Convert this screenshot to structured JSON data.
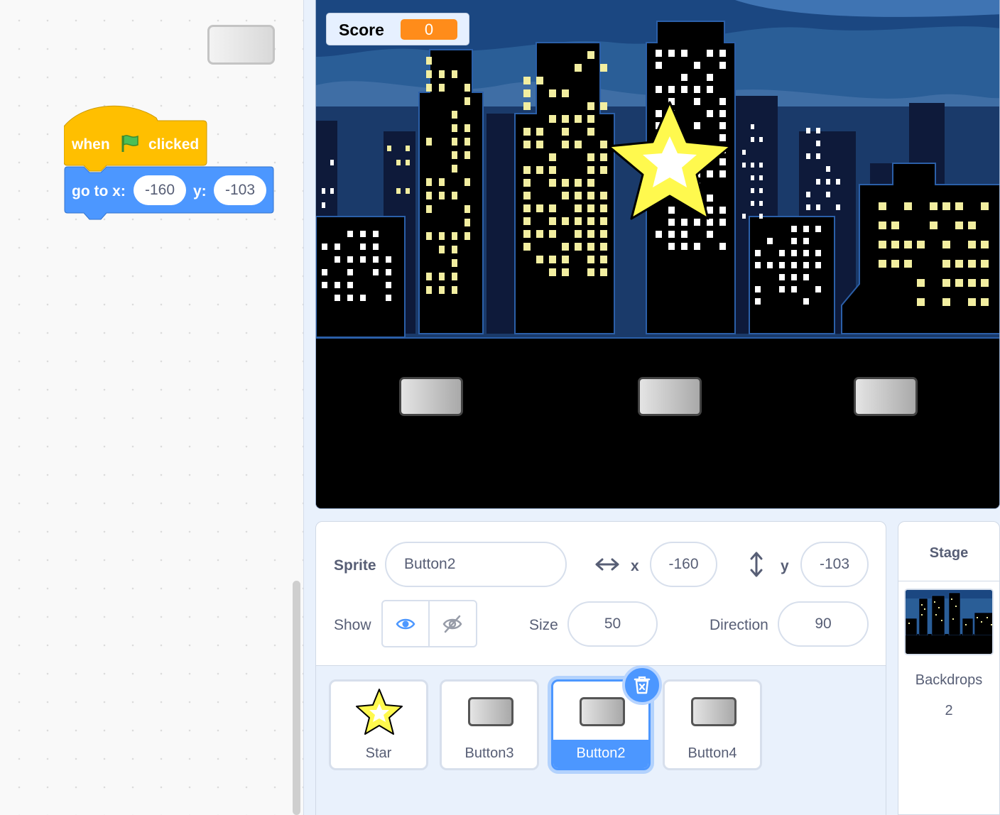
{
  "code_area": {
    "hat_block": {
      "when": "when",
      "clicked": "clicked",
      "flag_icon": "green-flag-icon"
    },
    "goto_block": {
      "label": "go to x:",
      "x": "-160",
      "y_label": "y:",
      "y": "-103"
    }
  },
  "stage": {
    "score_monitor": {
      "label": "Score",
      "value": "0"
    }
  },
  "sprite_info": {
    "sprite_label": "Sprite",
    "sprite_name": "Button2",
    "x_label": "x",
    "x_value": "-160",
    "y_label": "y",
    "y_value": "-103",
    "show_label": "Show",
    "size_label": "Size",
    "size_value": "50",
    "direction_label": "Direction",
    "direction_value": "90"
  },
  "sprites": [
    {
      "name": "Star",
      "icon": "star-icon"
    },
    {
      "name": "Button3",
      "icon": "button-icon"
    },
    {
      "name": "Button2",
      "icon": "button-icon",
      "selected": true
    },
    {
      "name": "Button4",
      "icon": "button-icon"
    }
  ],
  "stage_pane": {
    "title": "Stage",
    "backdrops_label": "Backdrops",
    "backdrops_count": "2"
  },
  "colors": {
    "motion_block": "#4c97ff",
    "event_block": "#ffbf00",
    "score_value": "#ff8c1a",
    "selected_sprite": "#4c97ff"
  }
}
